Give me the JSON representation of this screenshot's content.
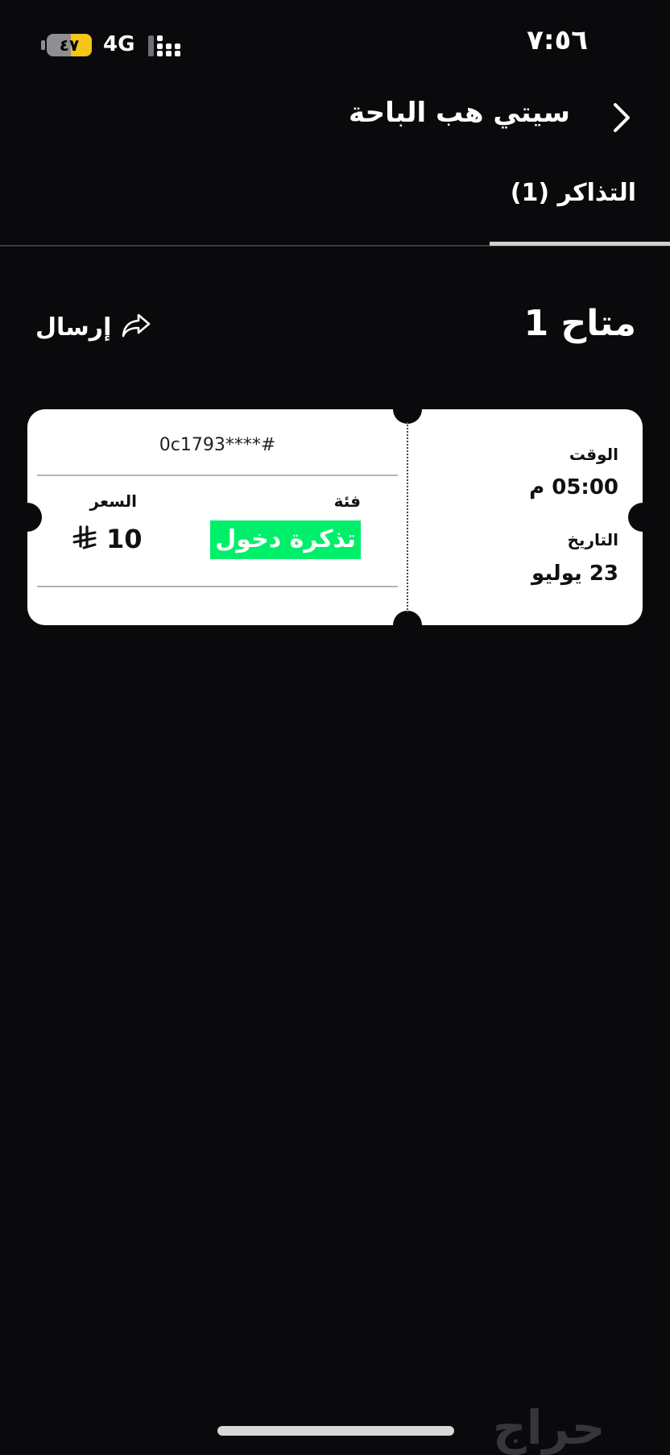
{
  "status_bar": {
    "time": "٧:٥٦",
    "battery_label": "٤٧",
    "battery_level": 0.47,
    "network": "4G"
  },
  "header": {
    "title": "سيتي هب الباحة",
    "tab_label": "التذاكر (1)"
  },
  "summary": {
    "available": "متاح 1",
    "send_label": "إرسال"
  },
  "ticket": {
    "code": "0c1793****#",
    "category_label": "فئة",
    "category_value": "تذكرة دخول",
    "price_label": "السعر",
    "price_value": "10",
    "time_label": "الوقت",
    "time_value": "05:00 م",
    "date_label": "التاريخ",
    "date_value": "23 يوليو"
  },
  "watermark": "حراج",
  "colors": {
    "background": "#0a0a0d",
    "ticket": "#ffffff",
    "category_badge": "#00ef6a",
    "battery": "#f5c518"
  },
  "icons": {
    "back": "chevron-right-icon",
    "send": "share-arrow-icon",
    "signal": "signal-bars-icon",
    "currency": "riyal-icon"
  }
}
